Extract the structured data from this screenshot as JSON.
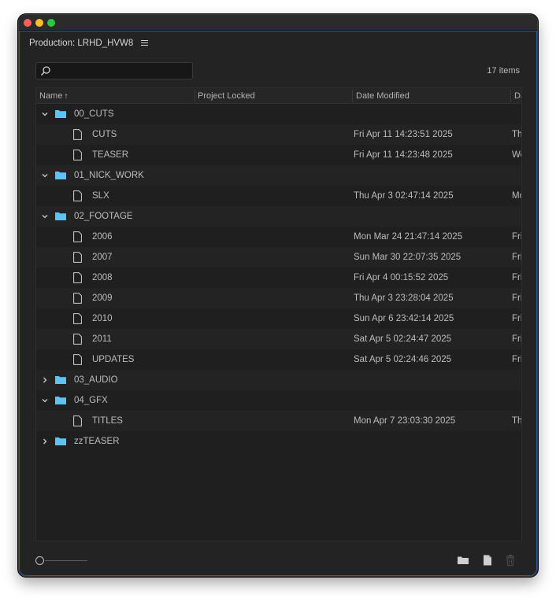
{
  "panel": {
    "title": "Production: LRHD_HVW8",
    "item_count": "17 items"
  },
  "search": {
    "value": "",
    "placeholder": ""
  },
  "columns": {
    "name": "Name",
    "project_locked": "Project Locked",
    "date_modified": "Date Modified",
    "date_created_partial": "Da"
  },
  "rows": [
    {
      "type": "folder",
      "expanded": true,
      "name": "00_CUTS",
      "date": "",
      "date2": ""
    },
    {
      "type": "file",
      "name": "CUTS",
      "date": "Fri Apr 11 14:23:51 2025",
      "date2": "Th"
    },
    {
      "type": "file",
      "name": "TEASER",
      "date": "Fri Apr 11 14:23:48 2025",
      "date2": "We"
    },
    {
      "type": "folder",
      "expanded": true,
      "name": "01_NICK_WORK",
      "date": "",
      "date2": ""
    },
    {
      "type": "file",
      "name": "SLX",
      "date": "Thu Apr  3 02:47:14 2025",
      "date2": "Mo"
    },
    {
      "type": "folder",
      "expanded": true,
      "name": "02_FOOTAGE",
      "date": "",
      "date2": ""
    },
    {
      "type": "file",
      "name": "2006",
      "date": "Mon Mar 24 21:47:14 2025",
      "date2": "Fri"
    },
    {
      "type": "file",
      "name": "2007",
      "date": "Sun Mar 30 22:07:35 2025",
      "date2": "Fri"
    },
    {
      "type": "file",
      "name": "2008",
      "date": "Fri Apr  4 00:15:52 2025",
      "date2": "Fri"
    },
    {
      "type": "file",
      "name": "2009",
      "date": "Thu Apr  3 23:28:04 2025",
      "date2": "Fri"
    },
    {
      "type": "file",
      "name": "2010",
      "date": "Sun Apr  6 23:42:14 2025",
      "date2": "Fri"
    },
    {
      "type": "file",
      "name": "2011",
      "date": "Sat Apr  5 02:24:47 2025",
      "date2": "Fri"
    },
    {
      "type": "file",
      "name": "UPDATES",
      "date": "Sat Apr  5 02:24:46 2025",
      "date2": "Fri"
    },
    {
      "type": "folder",
      "expanded": false,
      "name": "03_AUDIO",
      "date": "",
      "date2": ""
    },
    {
      "type": "folder",
      "expanded": true,
      "name": "04_GFX",
      "date": "",
      "date2": ""
    },
    {
      "type": "file",
      "name": "TITLES",
      "date": "Mon Apr  7 23:03:30 2025",
      "date2": "Th"
    },
    {
      "type": "folder",
      "expanded": false,
      "name": "zzTEASER",
      "date": "",
      "date2": ""
    }
  ],
  "icons": {
    "folder_color": "#5ec2f5",
    "border_accent": "#2e5a9a"
  }
}
